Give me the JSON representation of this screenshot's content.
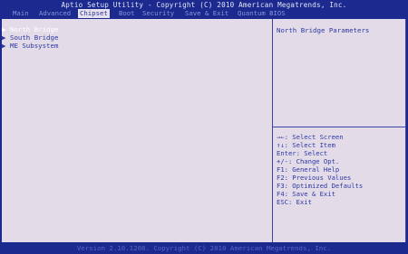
{
  "title": "Aptio Setup Utility - Copyright (C) 2010 American Megatrends, Inc.",
  "tabs": [
    {
      "label": "Main",
      "active": false
    },
    {
      "label": "Advanced",
      "active": false
    },
    {
      "label": "Chipset",
      "active": true
    },
    {
      "label": "Boot",
      "active": false
    },
    {
      "label": "Security",
      "active": false
    },
    {
      "label": "Save & Exit",
      "active": false
    },
    {
      "label": "Quantum BIOS",
      "active": false
    }
  ],
  "menu": {
    "items": [
      {
        "label": "North Bridge",
        "arrow": "▶",
        "selected": true
      },
      {
        "label": "South Bridge",
        "arrow": "▶",
        "selected": false
      },
      {
        "label": "ME Subsystem",
        "arrow": "▶",
        "selected": false
      }
    ]
  },
  "help": {
    "text": "North Bridge Parameters"
  },
  "keys": [
    "→←: Select Screen",
    "↑↓: Select Item",
    "Enter: Select",
    "+/-: Change Opt.",
    "F1: General Help",
    "F2: Previous Values",
    "F3: Optimized Defaults",
    "F4: Save & Exit",
    "ESC: Exit"
  ],
  "footer": "Version 2.10.1208. Copyright (C) 2010 American Megatrends, Inc.",
  "colors": {
    "background": "#1c2a8f",
    "panel": "#e3dbe8",
    "text": "#2c39a4",
    "highlight": "#ffffff"
  }
}
